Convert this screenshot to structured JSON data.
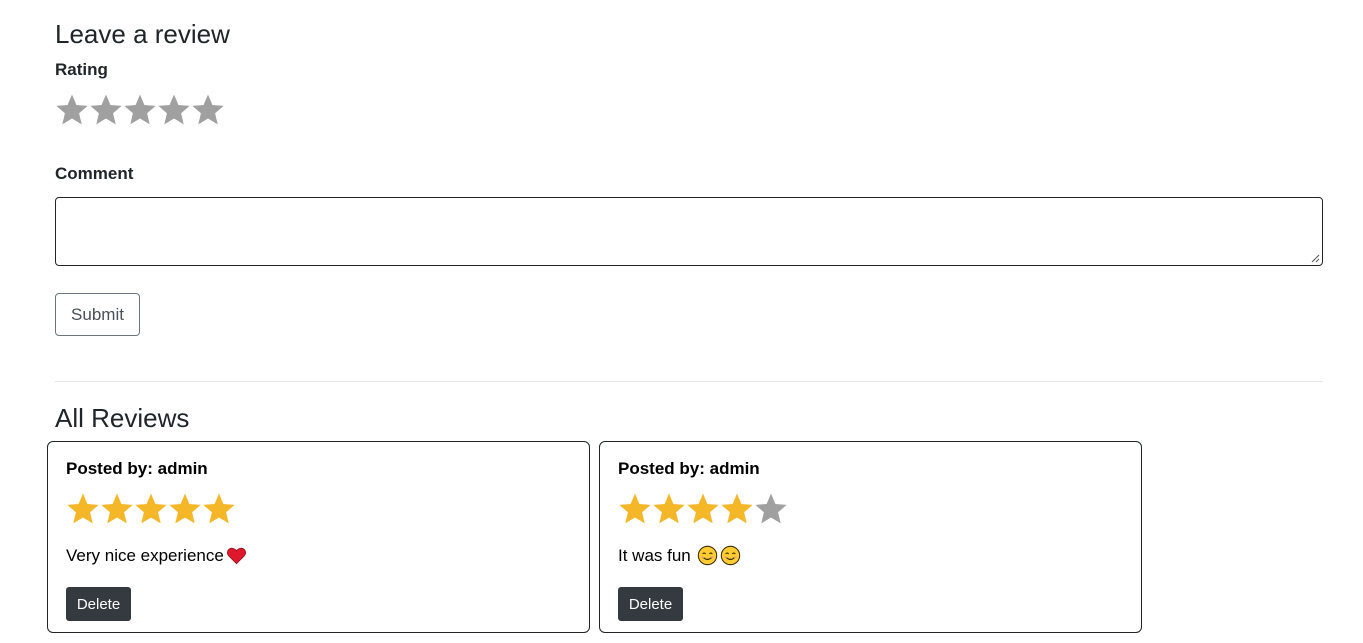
{
  "form": {
    "title": "Leave a review",
    "rating_label": "Rating",
    "rating_value": 0,
    "rating_max": 5,
    "comment_label": "Comment",
    "comment_value": "",
    "submit_label": "Submit"
  },
  "reviews": {
    "title": "All Reviews",
    "items": [
      {
        "posted_by": "Posted by: admin",
        "rating": 5,
        "text": "Very nice experience",
        "emojis": [
          "red-heart-icon"
        ],
        "delete_label": "Delete"
      },
      {
        "posted_by": "Posted by: admin",
        "rating": 4,
        "text": "It was fun ",
        "emojis": [
          "smiling-face-icon",
          "smiling-face-icon"
        ],
        "delete_label": "Delete"
      }
    ]
  },
  "colors": {
    "star_filled": "#f4b728",
    "star_empty": "#a0a0a0",
    "delete_bg": "#343a40",
    "heart": "#e0182d"
  }
}
